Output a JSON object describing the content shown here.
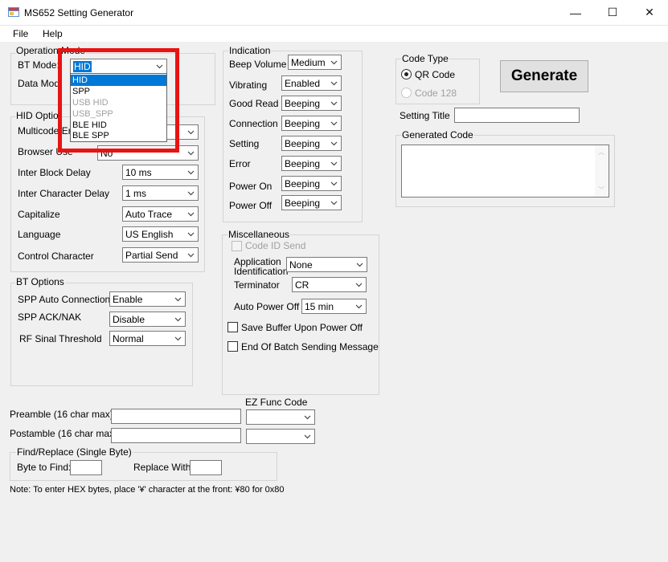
{
  "window": {
    "title": "MS652 Setting Generator",
    "minimize": "—",
    "maximize": "☐",
    "close": "✕"
  },
  "menu": [
    "File",
    "Help"
  ],
  "operation_mode": {
    "group": "Operation Mode",
    "bt_mode_label": "BT Mode:",
    "bt_mode_value": "HID",
    "data_mode_label": "Data Mod",
    "dropdown_options": [
      {
        "label": "HID",
        "state": "selected"
      },
      {
        "label": "SPP",
        "state": "normal"
      },
      {
        "label": "USB HID",
        "state": "disabled"
      },
      {
        "label": "USB_SPP",
        "state": "disabled"
      },
      {
        "label": "BLE HID",
        "state": "normal"
      },
      {
        "label": "BLE SPP",
        "state": "normal"
      }
    ]
  },
  "hid_options": {
    "group": "HID Optio",
    "rows": [
      {
        "label": "Multicode En",
        "value": ""
      },
      {
        "label": "Browser Use",
        "value": "No"
      },
      {
        "label": "Inter Block Delay",
        "value": "10 ms"
      },
      {
        "label": "Inter Character Delay",
        "value": "1 ms"
      },
      {
        "label": "Capitalize",
        "value": "Auto Trace"
      },
      {
        "label": "Language",
        "value": "US English"
      },
      {
        "label": "Control Character",
        "value": "Partial Send"
      }
    ]
  },
  "bt_options": {
    "group": "BT Options",
    "rows": [
      {
        "label": "SPP Auto Connection",
        "value": "Enable"
      },
      {
        "label": "SPP ACK/NAK",
        "value": "Disable"
      },
      {
        "label": "RF Sinal Threshold",
        "value": "Normal"
      }
    ]
  },
  "indication": {
    "group": "Indication",
    "rows": [
      {
        "label": "Beep Volume",
        "value": "Medium"
      },
      {
        "label": "Vibrating",
        "value": "Enabled"
      },
      {
        "label": "Good Read",
        "value": "Beeping"
      },
      {
        "label": "Connection",
        "value": "Beeping"
      },
      {
        "label": "Setting",
        "value": "Beeping"
      },
      {
        "label": "Error",
        "value": "Beeping"
      },
      {
        "label": "Power On",
        "value": "Beeping"
      },
      {
        "label": "Power Off",
        "value": "Beeping"
      }
    ]
  },
  "misc": {
    "group": "Miscellaneous",
    "code_id_send": "Code ID Send",
    "app_id_label_1": "Application",
    "app_id_label_2": "Identification",
    "app_id_value": "None",
    "terminator_label": "Terminator",
    "terminator_value": "CR",
    "auto_power_off_label": "Auto Power Off",
    "auto_power_off_value": "15 min",
    "save_buffer": "Save Buffer Upon Power Off",
    "end_of_batch": "End Of Batch Sending Message"
  },
  "code_type": {
    "group": "Code Type",
    "qr": "QR Code",
    "code128": "Code 128"
  },
  "generate": "Generate",
  "setting_title_label": "Setting Title",
  "setting_title_value": "",
  "generated_code_group": "Generated Code",
  "generated_code_value": "",
  "ez_func_code": "EZ Func Code",
  "preamble_label": "Preamble (16 char max):",
  "postamble_label": "Postamble (16 char max):",
  "find_replace": {
    "group": "Find/Replace (Single Byte)",
    "byte_to_find": "Byte to Find:",
    "replace_with": "Replace With:"
  },
  "note": "Note: To enter HEX bytes, place '¥' character at the front: ¥80 for 0x80"
}
